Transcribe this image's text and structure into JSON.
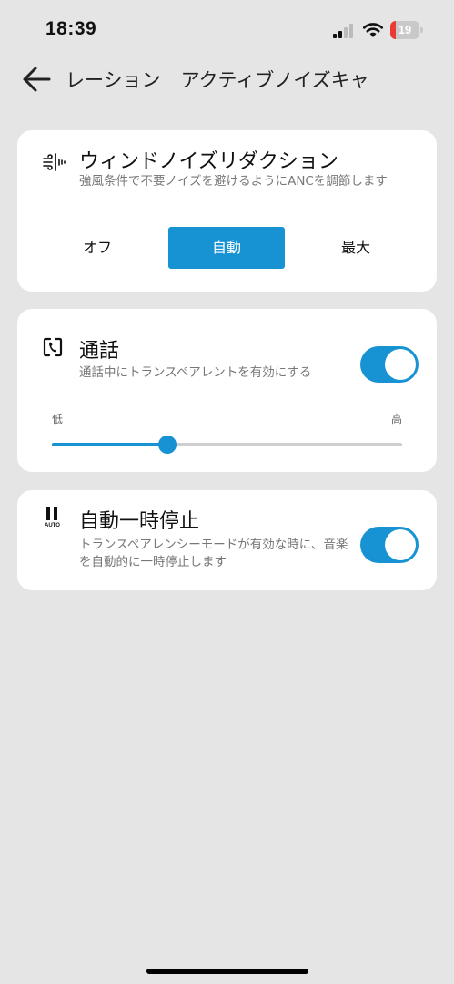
{
  "status": {
    "time": "18:39",
    "battery": "19",
    "battery_level": 0.19
  },
  "nav": {
    "tabs": [
      "レーション",
      "アクティブノイズキャ"
    ]
  },
  "wind": {
    "title": "ウィンドノイズリダクション",
    "description": "強風条件で不要ノイズを避けるようにANCを調節します",
    "options": [
      "オフ",
      "自動",
      "最大"
    ],
    "selected": "自動"
  },
  "call": {
    "title": "通話",
    "description": "通話中にトランスペアレントを有効にする",
    "toggle_on": true,
    "slider_low": "低",
    "slider_high": "高",
    "slider_value": 0.33
  },
  "autopause": {
    "title": "自動一時停止",
    "description": "トランスペアレンシーモードが有効な時に、音楽を自動的に一時停止します",
    "icon_label": "AUTO",
    "toggle_on": true
  },
  "colors": {
    "accent": "#1792d3",
    "background": "#e5e5e5",
    "card": "#ffffff"
  }
}
